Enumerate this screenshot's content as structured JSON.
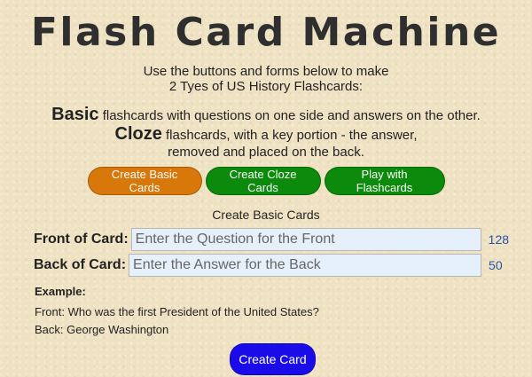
{
  "page": {
    "title": "Flash Card Machine",
    "intro_line1": "Use the buttons and forms below to make",
    "intro_line2": "2 Tyes of US History Flashcards:"
  },
  "types": {
    "basic_word": "Basic",
    "basic_desc": " flashcards with questions on one side and answers on the other.",
    "cloze_word": "Cloze",
    "cloze_desc": " flashcards, with a key portion - the answer,",
    "cloze_desc2": "removed and placed on the back."
  },
  "nav_buttons": {
    "create_basic": "Create Basic Cards",
    "create_cloze": "Create Cloze Cards",
    "play": "Play with Flashcards"
  },
  "form": {
    "section_title": "Create Basic Cards",
    "front_label": "Front of Card:",
    "front_placeholder": "Enter the Question for the Front",
    "front_value": "",
    "front_counter": "128",
    "back_label": "Back of Card:",
    "back_placeholder": "Enter the Answer for the Back",
    "back_value": "",
    "back_counter": "50",
    "submit": "Create Card"
  },
  "example": {
    "heading": "Example:",
    "front": "Front: Who was the first President of the United States?",
    "back": "Back: George Washington"
  },
  "colors": {
    "background": "#efe2c2",
    "basic_button": "#d9780a",
    "cloze_button": "#0b8a0b",
    "play_button": "#0b8a0b",
    "create_button": "#1a0ce8",
    "counter_text": "#2a4faa",
    "input_background": "#e6f0fb"
  }
}
